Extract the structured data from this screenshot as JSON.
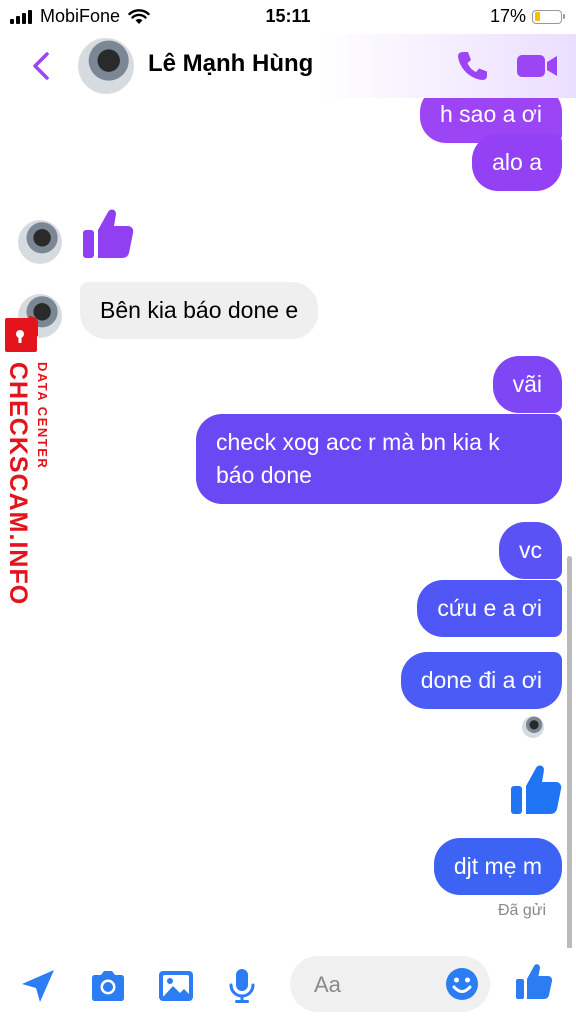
{
  "status_bar": {
    "carrier": "MobiFone",
    "time": "15:11",
    "battery": "17%"
  },
  "header": {
    "contact_name": "Lê Mạnh Hùng"
  },
  "messages": {
    "m1": "h sao a ơi",
    "m2": "alo a",
    "m3": "Bên kia báo done e",
    "m4": "vãi",
    "m5_line1": "check xog acc r mà bn kia k",
    "m5_line2": "báo done",
    "m6": "vc",
    "m7": "cứu e a ơi",
    "m8": "done đi a ơi",
    "m9": "djt mẹ m"
  },
  "delivery_status": "Đã gửi",
  "composer": {
    "placeholder": "Aa"
  },
  "watermark": {
    "main": "CHECKSCAM.INFO",
    "sub": "DATA CENTER"
  },
  "colors": {
    "accent_purple": "#9b45f5",
    "bubble_violet": "#8a44f6",
    "bubble_indigo": "#6a48f4",
    "bubble_blue": "#4a5cf5",
    "thumb_blue": "#1877f2",
    "incoming_bg": "#efefef",
    "watermark_red": "#e3141b"
  },
  "icons": [
    "back-chevron-icon",
    "phone-icon",
    "video-camera-icon",
    "thumbs-up-icon",
    "send-location-icon",
    "camera-icon",
    "gallery-icon",
    "microphone-icon",
    "emoji-icon"
  ]
}
